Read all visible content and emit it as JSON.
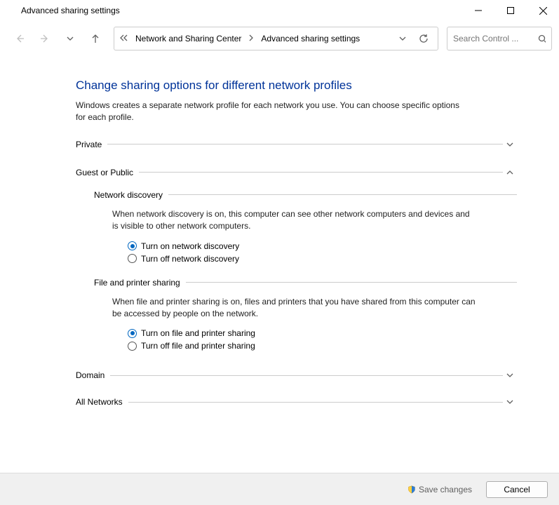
{
  "window": {
    "title": "Advanced sharing settings"
  },
  "breadcrumb": {
    "parent": "Network and Sharing Center",
    "current": "Advanced sharing settings"
  },
  "search": {
    "placeholder": "Search Control ..."
  },
  "page": {
    "heading": "Change sharing options for different network profiles",
    "description": "Windows creates a separate network profile for each network you use. You can choose specific options for each profile."
  },
  "sections": {
    "private": {
      "label": "Private"
    },
    "guest": {
      "label": "Guest or Public",
      "network_discovery": {
        "label": "Network discovery",
        "description": "When network discovery is on, this computer can see other network computers and devices and is visible to other network computers.",
        "opt_on": "Turn on network discovery",
        "opt_off": "Turn off network discovery"
      },
      "file_printer": {
        "label": "File and printer sharing",
        "description": "When file and printer sharing is on, files and printers that you have shared from this computer can be accessed by people on the network.",
        "opt_on": "Turn on file and printer sharing",
        "opt_off": "Turn off file and printer sharing"
      }
    },
    "domain": {
      "label": "Domain"
    },
    "all_networks": {
      "label": "All Networks"
    }
  },
  "footer": {
    "save": "Save changes",
    "cancel": "Cancel"
  }
}
